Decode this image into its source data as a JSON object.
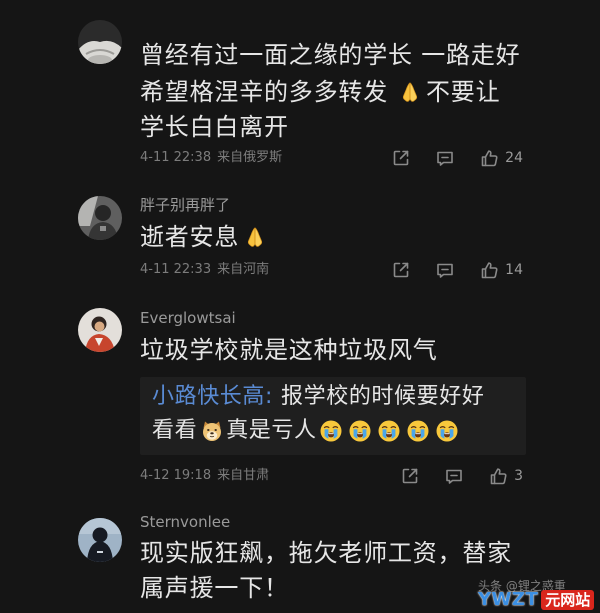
{
  "theme": {
    "background": "#151515",
    "text": "#e6e6e6",
    "muted": "#7c7c7c",
    "username": "#9a9a9a",
    "link": "#5a8bd4",
    "quote_background": "#1f1f1f",
    "icon": "#8a8a8a"
  },
  "action_icons": [
    "share-icon",
    "comment-icon",
    "thumbs-up-icon"
  ],
  "comments": [
    {
      "content": [
        {
          "text": "曾经有过一面之缘的学长 一路走好"
        },
        {
          "text": "希望格涅辛的多多转发",
          "emoji": "folded-hands",
          "after": "不要让"
        },
        {
          "text": "学长白白离开"
        }
      ],
      "time": "4-11 22:38",
      "location": "来自俄罗斯",
      "likes": "24"
    },
    {
      "username": "胖子别再胖了",
      "content": [
        {
          "text": "逝者安息",
          "emoji": "folded-hands"
        }
      ],
      "time": "4-11 22:33",
      "location": "来自河南",
      "likes": "14"
    },
    {
      "username": "Everglowtsai",
      "content": [
        {
          "text": "垃圾学校就是这种垃圾风气"
        }
      ],
      "reply": {
        "author": "小路快长高:",
        "line_1": "报学校的时候要好好",
        "line_2": {
          "before": "看看",
          "emoji": "doge",
          "after": "真是亏人",
          "trailing_emojis": [
            "loudly-crying",
            "loudly-crying",
            "loudly-crying",
            "loudly-crying",
            "loudly-crying"
          ]
        }
      },
      "time": "4-12 19:18",
      "location": "来自甘肃",
      "likes": "3"
    },
    {
      "username": "Sternvonlee",
      "content": [
        {
          "text": "现实版狂飙，拖欠老师工资，替家"
        },
        {
          "text": "属声援一下！"
        }
      ]
    }
  ],
  "watermark": {
    "text": "头条 @锂之惑重",
    "logo_letters": "YWZT",
    "logo_tag": "元网站"
  }
}
